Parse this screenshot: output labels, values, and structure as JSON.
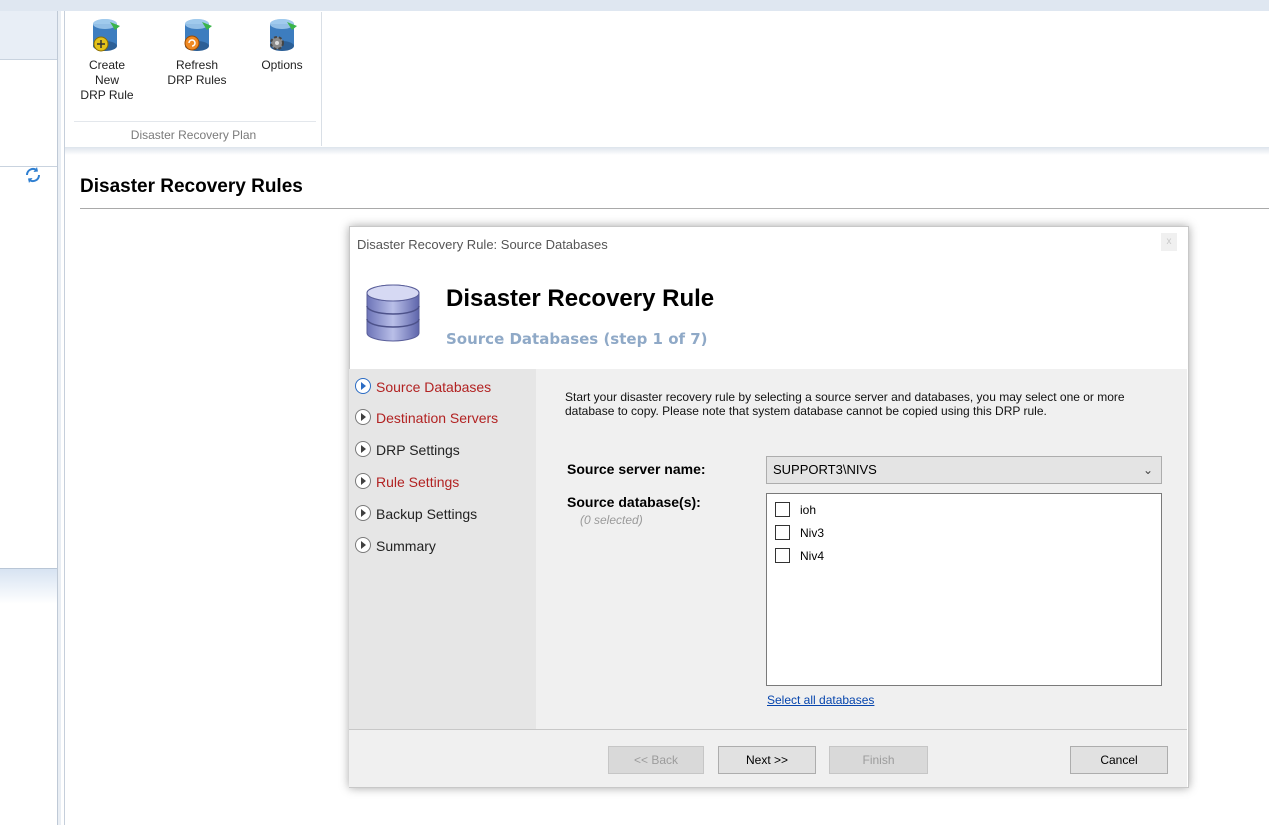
{
  "ribbon": {
    "buttons": [
      {
        "label_line1": "Create New",
        "label_line2": "DRP Rule",
        "icon": "create-drp-rule-icon"
      },
      {
        "label_line1": "Refresh",
        "label_line2": "DRP Rules",
        "icon": "refresh-drp-rules-icon"
      },
      {
        "label_line1": "Options",
        "label_line2": "",
        "icon": "options-icon"
      }
    ],
    "group_label": "Disaster Recovery Plan"
  },
  "page": {
    "title": "Disaster Recovery Rules"
  },
  "dialog": {
    "window_title": "Disaster Recovery Rule: Source Databases",
    "close_glyph": "x",
    "header_title": "Disaster Recovery Rule",
    "header_subtitle": "Source Databases (step 1 of 7)",
    "steps": [
      {
        "label": "Source Databases",
        "color": "#b22222",
        "active": true
      },
      {
        "label": "Destination Servers",
        "color": "#b22222"
      },
      {
        "label": "DRP Settings",
        "color": "#222222"
      },
      {
        "label": "Rule Settings",
        "color": "#b22222"
      },
      {
        "label": "Backup Settings",
        "color": "#222222"
      },
      {
        "label": "Summary",
        "color": "#222222"
      }
    ],
    "intro": "Start your disaster recovery rule by selecting a source server and databases, you may select one or more database to copy. Please note that system database cannot be copied using this DRP rule.",
    "server_label": "Source server name:",
    "server_value": "SUPPORT3\\NIVS",
    "databases_label": "Source database(s):",
    "selected_count": "(0 selected)",
    "databases": [
      {
        "name": "ioh",
        "checked": false
      },
      {
        "name": "Niv3",
        "checked": false
      },
      {
        "name": "Niv4",
        "checked": false
      }
    ],
    "select_all": "Select all databases",
    "buttons": {
      "back": "<< Back",
      "next": "Next >>",
      "finish": "Finish",
      "cancel": "Cancel"
    }
  },
  "colors": {
    "accent_subtitle": "#8fa9c7",
    "step_red": "#b22222",
    "link": "#0645ad"
  }
}
